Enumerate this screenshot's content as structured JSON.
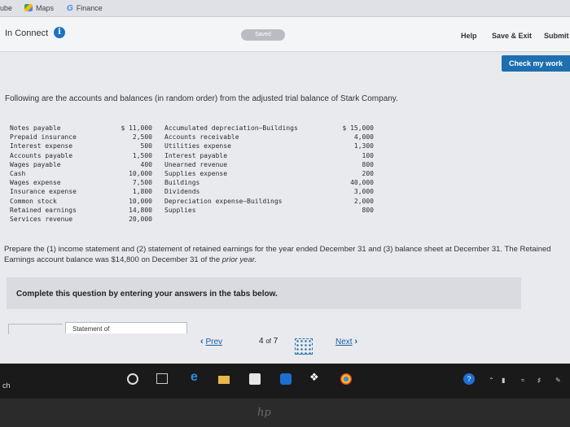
{
  "bookmarks": {
    "item_0": "ube",
    "item_1": "Maps",
    "item_2": "Finance"
  },
  "header": {
    "brand": "In Connect",
    "info_icon": "i",
    "saved": "Saved",
    "help": "Help",
    "save_exit": "Save & Exit",
    "submit": "Submit"
  },
  "check_work": "Check my work",
  "prompt_intro": "Following are the accounts and balances (in random order) from the adjusted trial balance of Stark Company.",
  "accounts_left": [
    {
      "name": "Notes payable",
      "amount": "$ 11,000"
    },
    {
      "name": "Prepaid insurance",
      "amount": "2,500"
    },
    {
      "name": "Interest expense",
      "amount": "500"
    },
    {
      "name": "Accounts payable",
      "amount": "1,500"
    },
    {
      "name": "Wages payable",
      "amount": "400"
    },
    {
      "name": "Cash",
      "amount": "10,000"
    },
    {
      "name": "Wages expense",
      "amount": "7,500"
    },
    {
      "name": "Insurance expense",
      "amount": "1,800"
    },
    {
      "name": "Common stock",
      "amount": "10,000"
    },
    {
      "name": "Retained earnings",
      "amount": "14,800"
    },
    {
      "name": "Services revenue",
      "amount": "20,000"
    }
  ],
  "accounts_right": [
    {
      "name": "Accumulated depreciation—Buildings",
      "amount": "$ 15,000"
    },
    {
      "name": "Accounts receivable",
      "amount": "4,000"
    },
    {
      "name": "Utilities expense",
      "amount": "1,300"
    },
    {
      "name": "Interest payable",
      "amount": "100"
    },
    {
      "name": "Unearned revenue",
      "amount": "800"
    },
    {
      "name": "Supplies expense",
      "amount": "200"
    },
    {
      "name": "Buildings",
      "amount": "40,000"
    },
    {
      "name": "Dividends",
      "amount": "3,000"
    },
    {
      "name": "Depreciation expense—Buildings",
      "amount": "2,000"
    },
    {
      "name": "Supplies",
      "amount": "800"
    }
  ],
  "prompt_task": "Prepare the (1) income statement and (2) statement of retained earnings for the year ended December 31 and (3) balance sheet at December 31. The Retained Earnings account balance was $14,800 on December 31 of the ",
  "prompt_task_italic": "prior year.",
  "instruction": "Complete this question by entering your answers in the tabs below.",
  "tabs": {
    "active": "Statement of"
  },
  "pager": {
    "prev": "Prev",
    "position": "4",
    "of": "of",
    "total": "7",
    "next": "Next"
  },
  "taskbar": {
    "search": "ch"
  },
  "bezel": "hp"
}
